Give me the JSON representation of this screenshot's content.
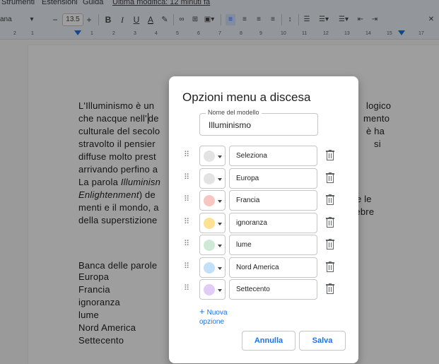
{
  "menubar": {
    "items": [
      "Strumenti",
      "Estensioni",
      "Guida"
    ],
    "last_edit": "Ultima modifica: 12 minuti fa"
  },
  "toolbar": {
    "font": "ana",
    "font_size": "13.5",
    "minus": "−",
    "plus": "+",
    "bold": "B",
    "italic": "I",
    "underline": "U",
    "text_color": "A"
  },
  "ruler": {
    "numbers": [
      "2",
      "1",
      "1",
      "2",
      "3",
      "4",
      "5",
      "6",
      "7",
      "8",
      "9",
      "10",
      "11",
      "12",
      "13",
      "14",
      "15",
      "17"
    ]
  },
  "document": {
    "lines": [
      [
        "L'Illuminismo è un",
        ""
      ],
      [
        "che nacque nell'",
        "de"
      ],
      [
        "culturale del secolo",
        ""
      ],
      [
        "stravolto il pensier",
        ""
      ],
      [
        "diffuse molto prest",
        ""
      ],
      [
        "arrivando perfino a",
        ""
      ]
    ],
    "line7": "La parola ",
    "line7_italic": "Illuminisn",
    "line8_italic": "Enlightenment",
    "line8_rest": ") de",
    "line9": "menti e il mondo, a",
    "line10": "della superstizione",
    "right_1": "logico",
    "right_2": "mento",
    "right_3": "è ha",
    "right_4": "si",
    "right_5": "are le",
    "right_6": "nebre",
    "bank_title": "Banca delle parole",
    "bank_words": [
      "Europa",
      "Francia",
      "ignoranza",
      "lume",
      "Nord America",
      "Settecento"
    ]
  },
  "dialog": {
    "title": "Opzioni menu a discesa",
    "template_label": "Nome del modello",
    "template_value": "Illuminismo",
    "options": [
      {
        "label": "Seleziona",
        "color": "#e3e3e3"
      },
      {
        "label": "Europa",
        "color": "#e3e3e3"
      },
      {
        "label": "Francia",
        "color": "#f8c6c1"
      },
      {
        "label": "ignoranza",
        "color": "#fde293"
      },
      {
        "label": "lume",
        "color": "#ceead6"
      },
      {
        "label": "Nord America",
        "color": "#c2e0f7"
      },
      {
        "label": "Settecento",
        "color": "#e1cbf7"
      }
    ],
    "add_plus": "+",
    "add_option": "Nuova opzione",
    "cancel_label": "Annulla",
    "save_label": "Salva"
  },
  "icons": {
    "drag": "drag-handle-icon",
    "trash": "trash-icon",
    "dropdown": "chevron-down-icon"
  },
  "colors": {
    "accent": "#1a73e8",
    "scrim": "rgba(0,0,0,0.38)"
  }
}
